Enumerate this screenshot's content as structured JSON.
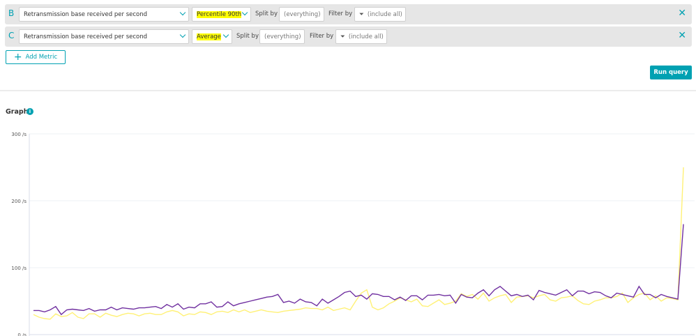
{
  "queries": [
    {
      "letter": "B",
      "metric": "Retransmission base received per second",
      "aggregation": "Percentile 90th",
      "split_label": "Split by",
      "split_value": "(everything)",
      "filter_label": "Filter by",
      "filter_value": "(include all)"
    },
    {
      "letter": "C",
      "metric": "Retransmission base received per second",
      "aggregation": "Average",
      "split_label": "Split by",
      "split_value": "(everything)",
      "filter_label": "Filter by",
      "filter_value": "(include all)"
    }
  ],
  "add_metric_label": "Add Metric",
  "run_query_label": "Run query",
  "graph_title": "Graph",
  "chart_data": {
    "type": "line",
    "yticks": [
      "300 /s",
      "200 /s",
      "100 /s",
      "0 /s"
    ],
    "ytick_values": [
      300,
      200,
      100,
      0
    ],
    "ylim": [
      0,
      300
    ],
    "series": [
      {
        "name": "B - Percentile 90th",
        "color": "#7030a0",
        "values": [
          36,
          36,
          34,
          37,
          42,
          30,
          37,
          38,
          37,
          36,
          39,
          35,
          37,
          37,
          41,
          37,
          40,
          39,
          38,
          40,
          40,
          41,
          42,
          39,
          45,
          41,
          46,
          38,
          41,
          40,
          46,
          46,
          49,
          41,
          42,
          49,
          43,
          46,
          48,
          50,
          52,
          54,
          56,
          57,
          60,
          48,
          50,
          47,
          53,
          49,
          48,
          43,
          53,
          47,
          52,
          57,
          63,
          65,
          57,
          59,
          53,
          61,
          60,
          57,
          57,
          52,
          56,
          51,
          58,
          58,
          52,
          59,
          59,
          60,
          58,
          59,
          47,
          60,
          56,
          55,
          62,
          67,
          58,
          67,
          72,
          65,
          58,
          60,
          57,
          59,
          52,
          66,
          63,
          61,
          59,
          63,
          67,
          58,
          65,
          65,
          61,
          64,
          63,
          58,
          55,
          62,
          60,
          58,
          56,
          72,
          60,
          60,
          55,
          60,
          57,
          55,
          53,
          165
        ]
      },
      {
        "name": "C - Average",
        "color": "#fff176",
        "values": [
          30,
          26,
          24,
          23,
          31,
          27,
          28,
          33,
          26,
          24,
          31,
          31,
          26,
          32,
          29,
          27,
          30,
          32,
          31,
          28,
          31,
          32,
          30,
          30,
          34,
          36,
          34,
          28,
          31,
          30,
          34,
          33,
          30,
          34,
          35,
          33,
          37,
          34,
          37,
          33,
          35,
          37,
          35,
          34,
          33,
          35,
          36,
          37,
          38,
          40,
          39,
          39,
          37,
          41,
          36,
          38,
          40,
          37,
          50,
          62,
          67,
          41,
          37,
          40,
          46,
          50,
          55,
          52,
          49,
          53,
          43,
          42,
          47,
          52,
          45,
          47,
          50,
          61,
          57,
          60,
          53,
          62,
          50,
          55,
          58,
          60,
          48,
          56,
          57,
          58,
          55,
          58,
          60,
          52,
          50,
          55,
          56,
          58,
          51,
          46,
          45,
          50,
          52,
          55,
          55,
          57,
          62,
          48,
          55,
          60,
          62,
          52,
          58,
          50,
          55,
          54,
          52,
          250
        ]
      }
    ]
  }
}
